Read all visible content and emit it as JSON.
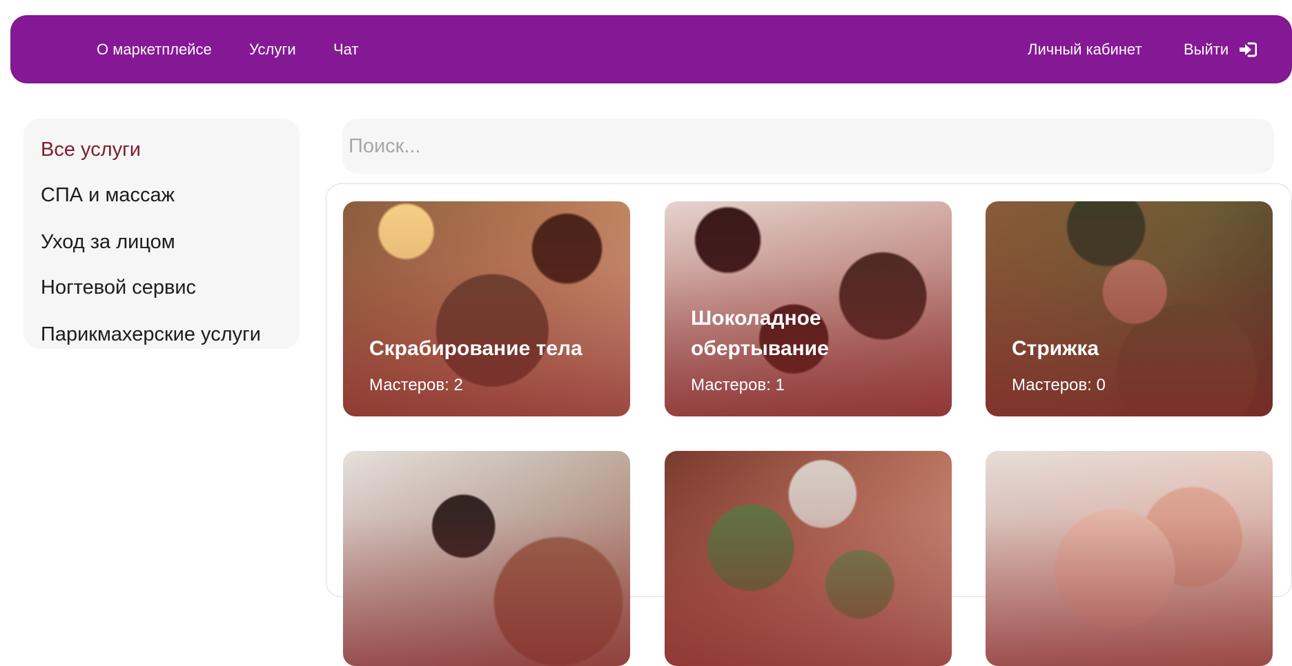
{
  "header": {
    "nav": {
      "about": "О маркетплейсе",
      "services": "Услуги",
      "chat": "Чат"
    },
    "user": {
      "cabinet": "Личный кабинет",
      "logout": "Выйти",
      "logout_icon": "sign-out-icon"
    }
  },
  "sidebar": {
    "items": [
      {
        "label": "Все услуги",
        "active": true
      },
      {
        "label": "СПА и массаж",
        "active": false
      },
      {
        "label": "Уход за лицом",
        "active": false
      },
      {
        "label": "Ногтевой сервис",
        "active": false
      },
      {
        "label": "Парикмахерские услуги",
        "active": false
      }
    ]
  },
  "search": {
    "placeholder": "Поиск...",
    "value": ""
  },
  "cards": [
    {
      "title": "Скрабирование тела",
      "count": "Мастеров: 2"
    },
    {
      "title": "Шоколадное обертывание",
      "count": "Мастеров: 1"
    },
    {
      "title": "Стрижка",
      "count": "Мастеров: 0"
    },
    {
      "title": "",
      "count": ""
    },
    {
      "title": "",
      "count": ""
    },
    {
      "title": "",
      "count": ""
    }
  ],
  "colors": {
    "header_bg": "#841895",
    "active_category": "#7d1d2c",
    "panel_bg": "#f6f6f6"
  }
}
